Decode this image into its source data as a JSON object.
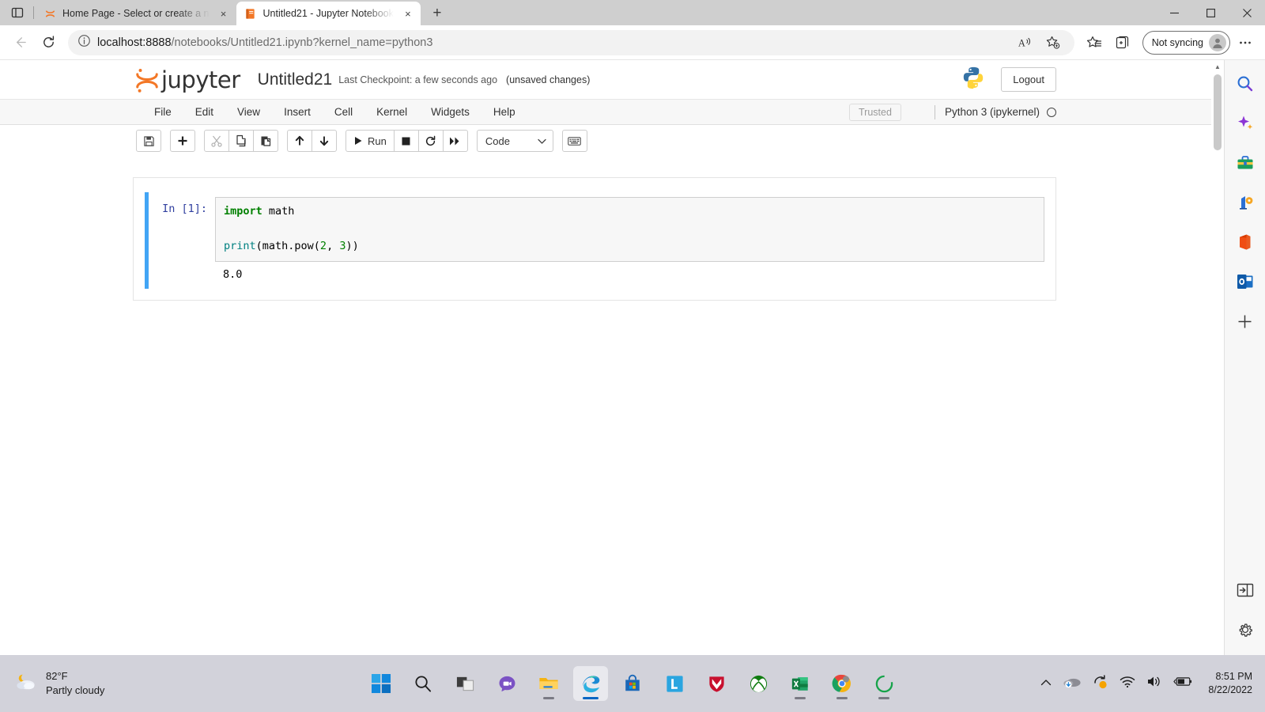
{
  "browser": {
    "tabs": [
      {
        "title": "Home Page - Select or create a n",
        "favicon": "jupyter-favicon",
        "active": false
      },
      {
        "title": "Untitled21 - Jupyter Notebook",
        "favicon": "notebook-favicon",
        "active": true
      }
    ],
    "new_tab_label": "+",
    "tab_close_label": "×",
    "address": {
      "scheme_host": "localhost:8888",
      "path": "/notebooks/Untitled21.ipynb?kernel_name=python3"
    },
    "profile": {
      "label": "Not syncing"
    },
    "window_controls": {
      "minimize": "–",
      "maximize": "❐",
      "close": "×"
    },
    "toolbar_icons": {
      "back": "back-arrow-icon",
      "refresh": "refresh-icon",
      "info": "site-info-icon",
      "read_aloud": "read-aloud-icon",
      "add_favorite": "add-favorite-icon",
      "favorites": "favorites-icon",
      "collections": "collections-icon",
      "settings_menu": "more-options-icon"
    },
    "sidebar_icons": [
      "search-icon",
      "copilot-sparkle-icon",
      "shopping-tools-icon",
      "games-icon",
      "office-icon",
      "outlook-icon",
      "add-sidebar-icon"
    ],
    "sidebar_bottom_icons": [
      "split-pane-icon",
      "settings-gear-icon"
    ]
  },
  "jupyter": {
    "logo_text": "jupyter",
    "notebook_title": "Untitled21",
    "checkpoint": "Last Checkpoint: a few seconds ago",
    "unsaved": "(unsaved changes)",
    "logout_label": "Logout",
    "trusted_label": "Trusted",
    "kernel_name": "Python 3 (ipykernel)",
    "menu": [
      "File",
      "Edit",
      "View",
      "Insert",
      "Cell",
      "Kernel",
      "Widgets",
      "Help"
    ],
    "toolbar": {
      "save_title": "save-icon",
      "insert_title": "add-cell-icon",
      "cut_title": "cut-icon",
      "copy_title": "copy-icon",
      "paste_title": "paste-icon",
      "moveup_title": "move-up-icon",
      "movedown_title": "move-down-icon",
      "run_label": "Run",
      "stop_title": "stop-icon",
      "restart_title": "restart-kernel-icon",
      "restart_run_title": "restart-run-all-icon",
      "cell_type": "Code",
      "command_palette_title": "command-palette-icon"
    },
    "cell": {
      "prompt": "In [1]:",
      "code_line_1_kw": "import",
      "code_line_1_rest": " math",
      "code_line_2_fn": "print",
      "code_line_2_a": "(math.pow(",
      "code_line_2_n1": "2",
      "code_line_2_b": ", ",
      "code_line_2_n2": "3",
      "code_line_2_c": "))",
      "output": "8.0"
    }
  },
  "taskbar": {
    "weather": {
      "temp": "82°F",
      "condition": "Partly cloudy",
      "icon": "partly-cloudy-icon"
    },
    "apps": [
      "start-icon",
      "search-icon",
      "task-view-icon",
      "chat-icon",
      "file-explorer-icon",
      "edge-icon",
      "microsoft-store-icon",
      "linkedin-icon",
      "mcafee-icon",
      "xbox-icon",
      "excel-icon",
      "chrome-icon",
      "jupyter-icon"
    ],
    "tray": {
      "show_hidden": "chevron-up-icon",
      "onedrive": "onedrive-icon",
      "update": "windows-update-icon",
      "wifi": "wifi-icon",
      "volume": "volume-icon",
      "battery": "battery-icon"
    },
    "clock": {
      "time": "8:51 PM",
      "date": "8/22/2022"
    }
  },
  "colors": {
    "accent_blue": "#42a5f5",
    "jupyter_orange": "#f37726",
    "keyword_green": "#008000",
    "function_teal": "#008080",
    "prompt_navy": "#303f9f"
  }
}
